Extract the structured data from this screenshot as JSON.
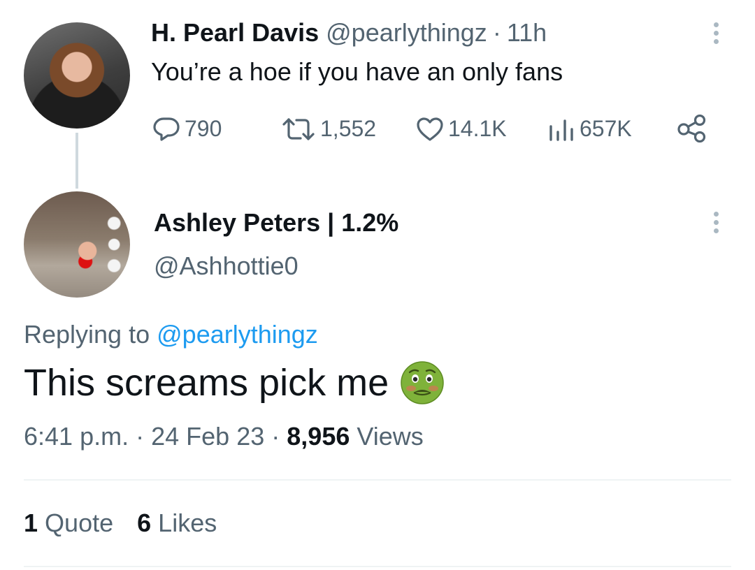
{
  "parent_tweet": {
    "author_name": "H. Pearl Davis",
    "handle": "@pearlythingz",
    "separator": "·",
    "time_ago": "11h",
    "text": "You’re a hoe if you have an only fans",
    "actions": {
      "replies": "790",
      "retweets": "1,552",
      "likes": "14.1K",
      "views": "657K"
    },
    "icons": [
      "reply-icon",
      "retweet-icon",
      "like-icon",
      "views-icon",
      "share-icon",
      "more-icon"
    ]
  },
  "reply_tweet": {
    "author_name": "Ashley Peters | 1.2%",
    "handle": "@Ashhottie0",
    "replying_prefix": "Replying to",
    "replying_to": "@pearlythingz",
    "text": "This screams pick me",
    "emoji": "nauseated-face",
    "time": "6:41 p.m.",
    "date": "24 Feb 23",
    "separator": "·",
    "views_count": "8,956",
    "views_label": "Views",
    "quotes_count": "1",
    "quotes_label": "Quote",
    "likes_count": "6",
    "likes_label": "Likes"
  },
  "colors": {
    "text_primary": "#0f1419",
    "text_secondary": "#536471",
    "link": "#1d9bf0",
    "divider": "#eff3f4",
    "thread_line": "#cfd9de"
  }
}
